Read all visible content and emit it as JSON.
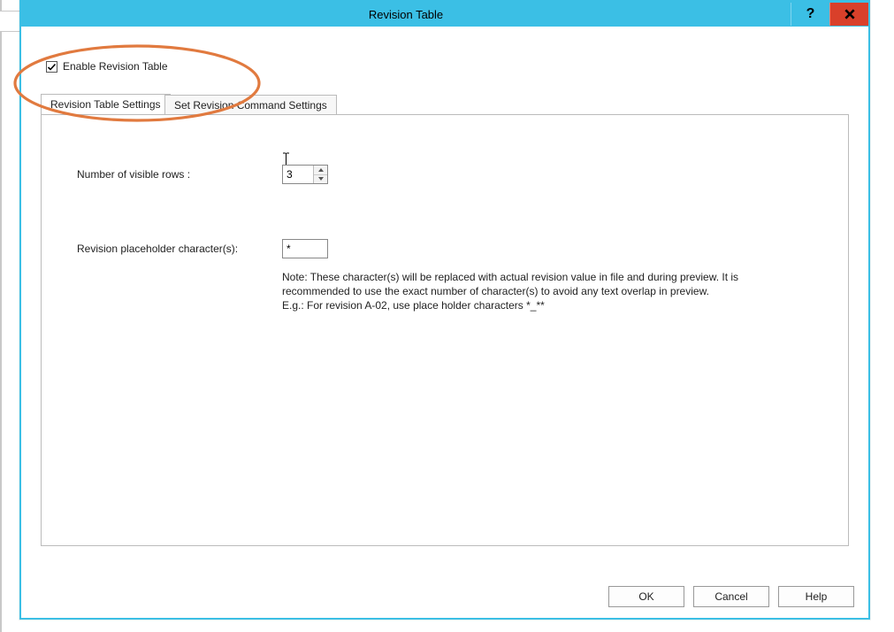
{
  "window": {
    "title": "Revision Table"
  },
  "enable": {
    "label": "Enable Revision Table",
    "checked": true
  },
  "tabs": {
    "t1": "Revision Table Settings",
    "t2": "Set Revision Command Settings"
  },
  "settings": {
    "rows_label": "Number of visible rows :",
    "rows_value": "3",
    "placeholder_label": "Revision placeholder character(s):",
    "placeholder_value": "*",
    "note_line1": "Note: These character(s) will be replaced with actual revision value in file and during preview. It is",
    "note_line2": "recommended to use the exact number of character(s) to avoid any text overlap in preview.",
    "note_line3": "E.g.: For revision A-02, use place holder characters *_**"
  },
  "buttons": {
    "ok": "OK",
    "cancel": "Cancel",
    "help": "Help"
  }
}
